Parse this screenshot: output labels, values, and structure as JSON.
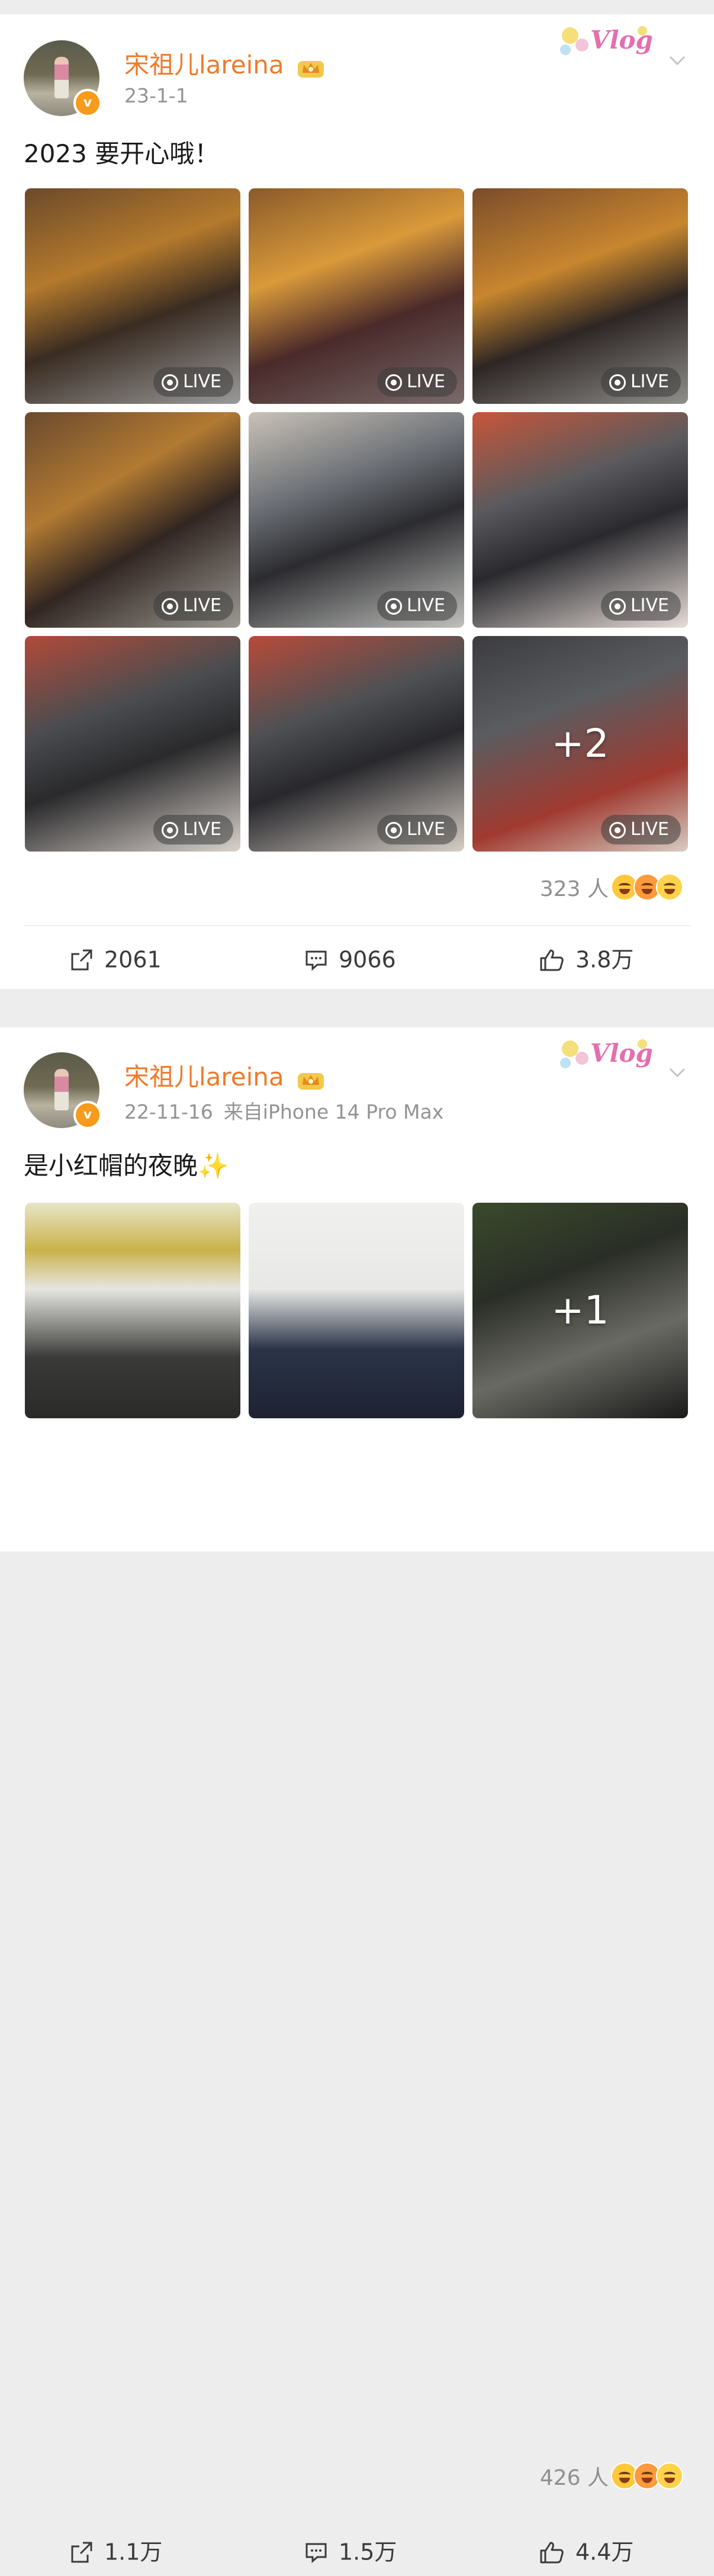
{
  "posts": [
    {
      "username": "宋祖儿lareina",
      "date": "23-1-1",
      "source": "",
      "text": "2023 要开心哦！",
      "live_label": "LIVE",
      "more_count": "+2",
      "reaction_count": "323 人",
      "actions": {
        "repost": "2061",
        "comments": "9066",
        "likes": "3.8万"
      }
    },
    {
      "username": "宋祖儿lareina",
      "date": "22-11-16",
      "source": "来自iPhone 14 Pro Max",
      "text": "是小红帽的夜晚✨",
      "more_count": "+1",
      "reaction_count": "426 人",
      "actions": {
        "repost": "1.1万",
        "comments": "1.5万",
        "likes": "4.4万"
      }
    }
  ],
  "sticker_text": "Vlog",
  "colors": {
    "username": "#f07a2a",
    "verified": "#f79b1c",
    "meta": "#939393"
  }
}
